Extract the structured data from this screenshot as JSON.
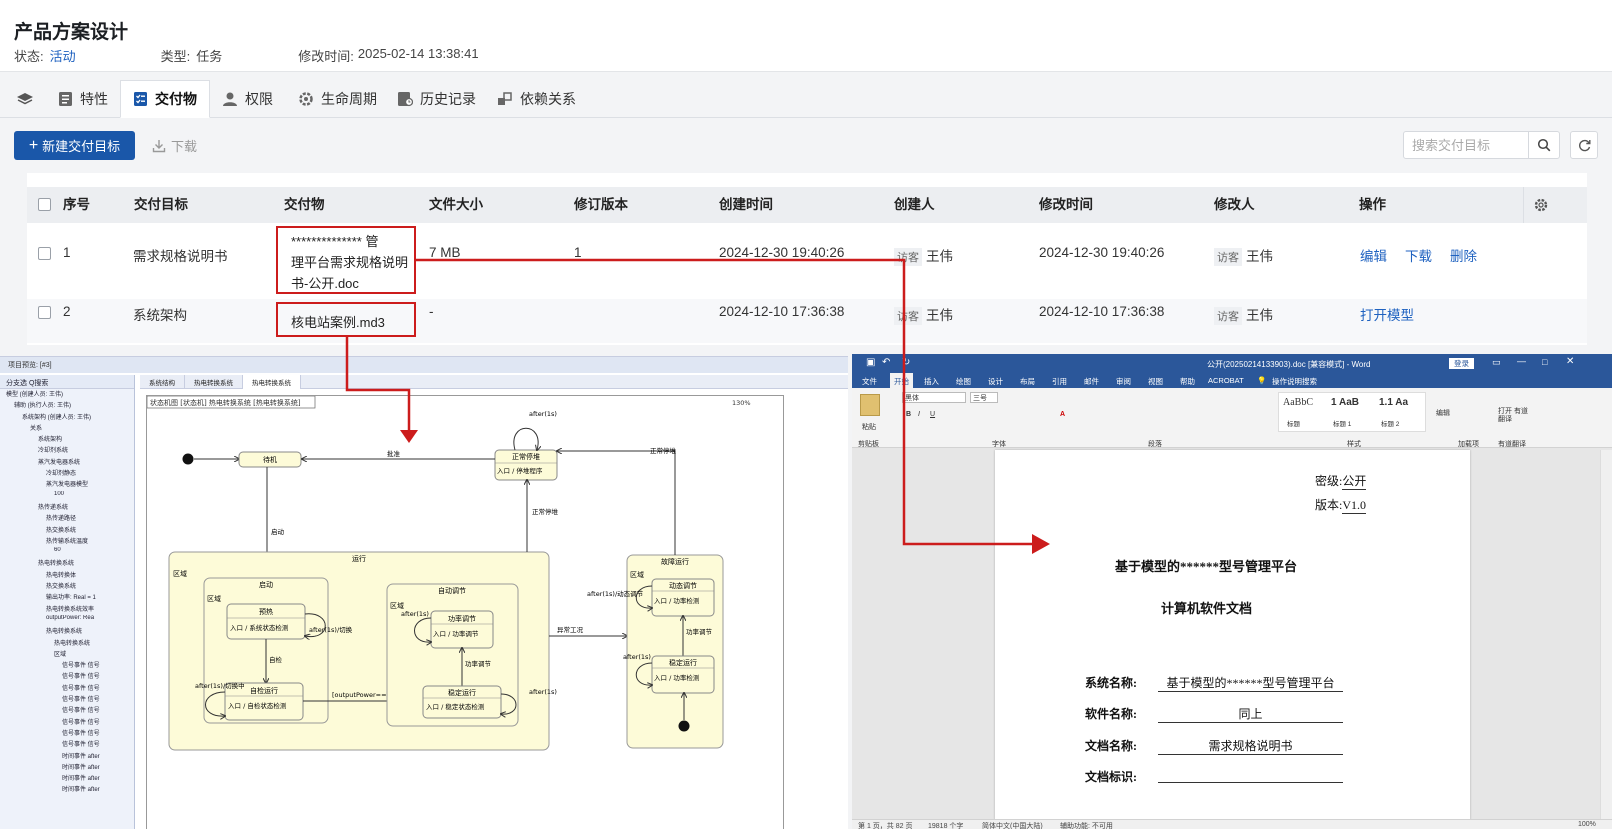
{
  "header": {
    "title": "产品方案设计",
    "status_label": "状态:",
    "status_value": "活动",
    "type_label": "类型:",
    "type_value": "任务",
    "modified_label": "修改时间:",
    "modified_value": "2025-02-14 13:38:41"
  },
  "tabs": [
    {
      "label": "特性",
      "icon": "list-icon"
    },
    {
      "label": "交付物",
      "icon": "checklist-icon",
      "active": true
    },
    {
      "label": "权限",
      "icon": "user-icon"
    },
    {
      "label": "生命周期",
      "icon": "gear-icon"
    },
    {
      "label": "历史记录",
      "icon": "history-icon"
    },
    {
      "label": "依赖关系",
      "icon": "dependency-icon"
    }
  ],
  "toolbar": {
    "new_label": "新建交付目标",
    "download_label": "下载",
    "search_placeholder": "搜索交付目标"
  },
  "table": {
    "columns": [
      "序号",
      "交付目标",
      "交付物",
      "文件大小",
      "修订版本",
      "创建时间",
      "创建人",
      "修改时间",
      "修改人",
      "操作"
    ],
    "rows": [
      {
        "seq": "1",
        "target": "需求规格说明书",
        "deliverable_l1": "************** 管",
        "deliverable_l2": "理平台需求规格说明",
        "deliverable_l3": "书-公开.doc",
        "size": "7 MB",
        "revision": "1",
        "created": "2024-12-30 19:40:26",
        "creator_tag": "访客",
        "creator": "王伟",
        "modified": "2024-12-30 19:40:26",
        "modifier_tag": "访客",
        "modifier": "王伟",
        "ops": [
          "编辑",
          "下载",
          "删除"
        ]
      },
      {
        "seq": "2",
        "target": "系统架构",
        "deliverable": "核电站案例.md3",
        "size": "-",
        "created": "2024-12-10 17:36:38",
        "creator_tag": "访客",
        "creator": "王伟",
        "modified": "2024-12-10 17:36:38",
        "modifier_tag": "访客",
        "modifier": "王伟",
        "ops": [
          "打开模型"
        ]
      }
    ]
  },
  "model_tool": {
    "topbar": "项目预览:  [#3]",
    "tree_head": "分支选  Q搜索",
    "tabs": [
      "系统结构",
      "热电转换系统",
      "热电转换系统"
    ],
    "diagram_title": "状态机图 [状态机] 热电转换系统 [热电转换系统]",
    "zoom": "130%",
    "tree_nodes": [
      "模型 (创建人员: 王伟)",
      "辅助 (执行人员: 王伟)",
      "系统架构 (创建人员: 王伟)",
      "关系",
      "系统架构",
      "冷却剂系统",
      "蒸汽发电器系统",
      "冷却剂静态",
      "蒸汽发电器模型",
      "100",
      "热传递系统",
      "热传递路径",
      "热交换系统",
      "热传输系统温度",
      "60",
      "热电转换系统",
      "热电转换体",
      "热交换系统",
      "输出功率: Real = 1",
      "热电转换系统效率",
      "outputPower: Rea",
      "热电转换系统",
      "热电转换系统",
      "区域",
      "信号事件 信号",
      "信号事件 信号",
      "信号事件 信号",
      "信号事件 信号",
      "信号事件 信号",
      "信号事件 信号",
      "信号事件 信号",
      "信号事件 信号",
      "时间事件 after",
      "时间事件 after",
      "时间事件 after",
      "时间事件 after"
    ],
    "states": {
      "standby": "待机",
      "stopping": "正常停堆",
      "stopping_sub": "入口 / 停堆程序",
      "running": "运行",
      "region": "区域",
      "startup": "启动",
      "preheat": "预热",
      "preheat_sub": "入口 / 系统状态检测",
      "self_check": "自检运行",
      "self_check_sub": "入口 / 自检状态检测",
      "auto_adjust": "自动调节",
      "power_adjust": "功率调节",
      "power_adjust_sub": "入口 / 功率调节",
      "stable": "稳定运行",
      "stable_sub": "入口 / 稳定状态检测",
      "fault": "故障运行",
      "dynamic": "动态调节",
      "dynamic_sub": "入口 / 功率检测",
      "steady": "稳定运行",
      "steady_sub": "入口 / 功率检测"
    },
    "transitions": {
      "approve": "批准",
      "after1s": "after(1s)",
      "start": "启动",
      "normal_stop": "正常停堆",
      "normal_stop2": "正常停堆",
      "after_switch": "after(1s)/切换",
      "self_start": "自检",
      "after_switch2": "after(1s)/切换中",
      "output_guard": "[outputPower==10]",
      "after1s_b": "after(1s)",
      "fault_switch": "异常工况",
      "after_dyn": "after(1s)/动态调节",
      "power_adj": "功率调节",
      "adjust2": "功率调节",
      "after_left": "after(1s)",
      "after_left2": "after(1s)"
    }
  },
  "word": {
    "title": "公开(20250214133903).doc [兼容模式] - Word",
    "login": "登录",
    "menu": [
      "文件",
      "开始",
      "插入",
      "绘图",
      "设计",
      "布局",
      "引用",
      "邮件",
      "审阅",
      "视图",
      "帮助",
      "ACROBAT",
      "操作说明搜索"
    ],
    "ribbon": {
      "paste": "粘贴",
      "clipboard": "剪贴板",
      "font_name": "黑体",
      "font_size": "三号",
      "font_group": "字体",
      "para_group": "段落",
      "styles": [
        "AaBbC",
        "1 AaB",
        "1.1 Aa"
      ],
      "style_names": [
        "标题",
        "标题 1",
        "标题 2"
      ],
      "style_group": "样式",
      "edit": "编辑",
      "addin": "加载项",
      "translate": "打开 有道翻译",
      "translate2": "有道翻译",
      "load": "加载项"
    },
    "page": {
      "security_label": "密级:",
      "security_value": "公开",
      "version_label": "版本:",
      "version_value": "V1.0",
      "heading1": "基于模型的******型号管理平台",
      "heading2": "计算机软件文档",
      "sys_label": "系统名称:",
      "sys_value": "基于模型的******型号管理平台",
      "sw_label": "软件名称:",
      "sw_value": "同上",
      "doc_label": "文档名称:",
      "doc_value": "需求规格说明书",
      "id_label": "文档标识:"
    },
    "status": {
      "page": "第 1 页，共 82 页",
      "words": "19818 个字",
      "lang": "简体中文(中国大陆)",
      "access": "辅助功能: 不可用",
      "zoom": "100%"
    }
  },
  "colors": {
    "primary": "#1a57a9",
    "link": "#1f62c0",
    "highlight_red": "#cc1c1c",
    "word_blue": "#2b579a",
    "state_fill": "#fdfbd8"
  }
}
